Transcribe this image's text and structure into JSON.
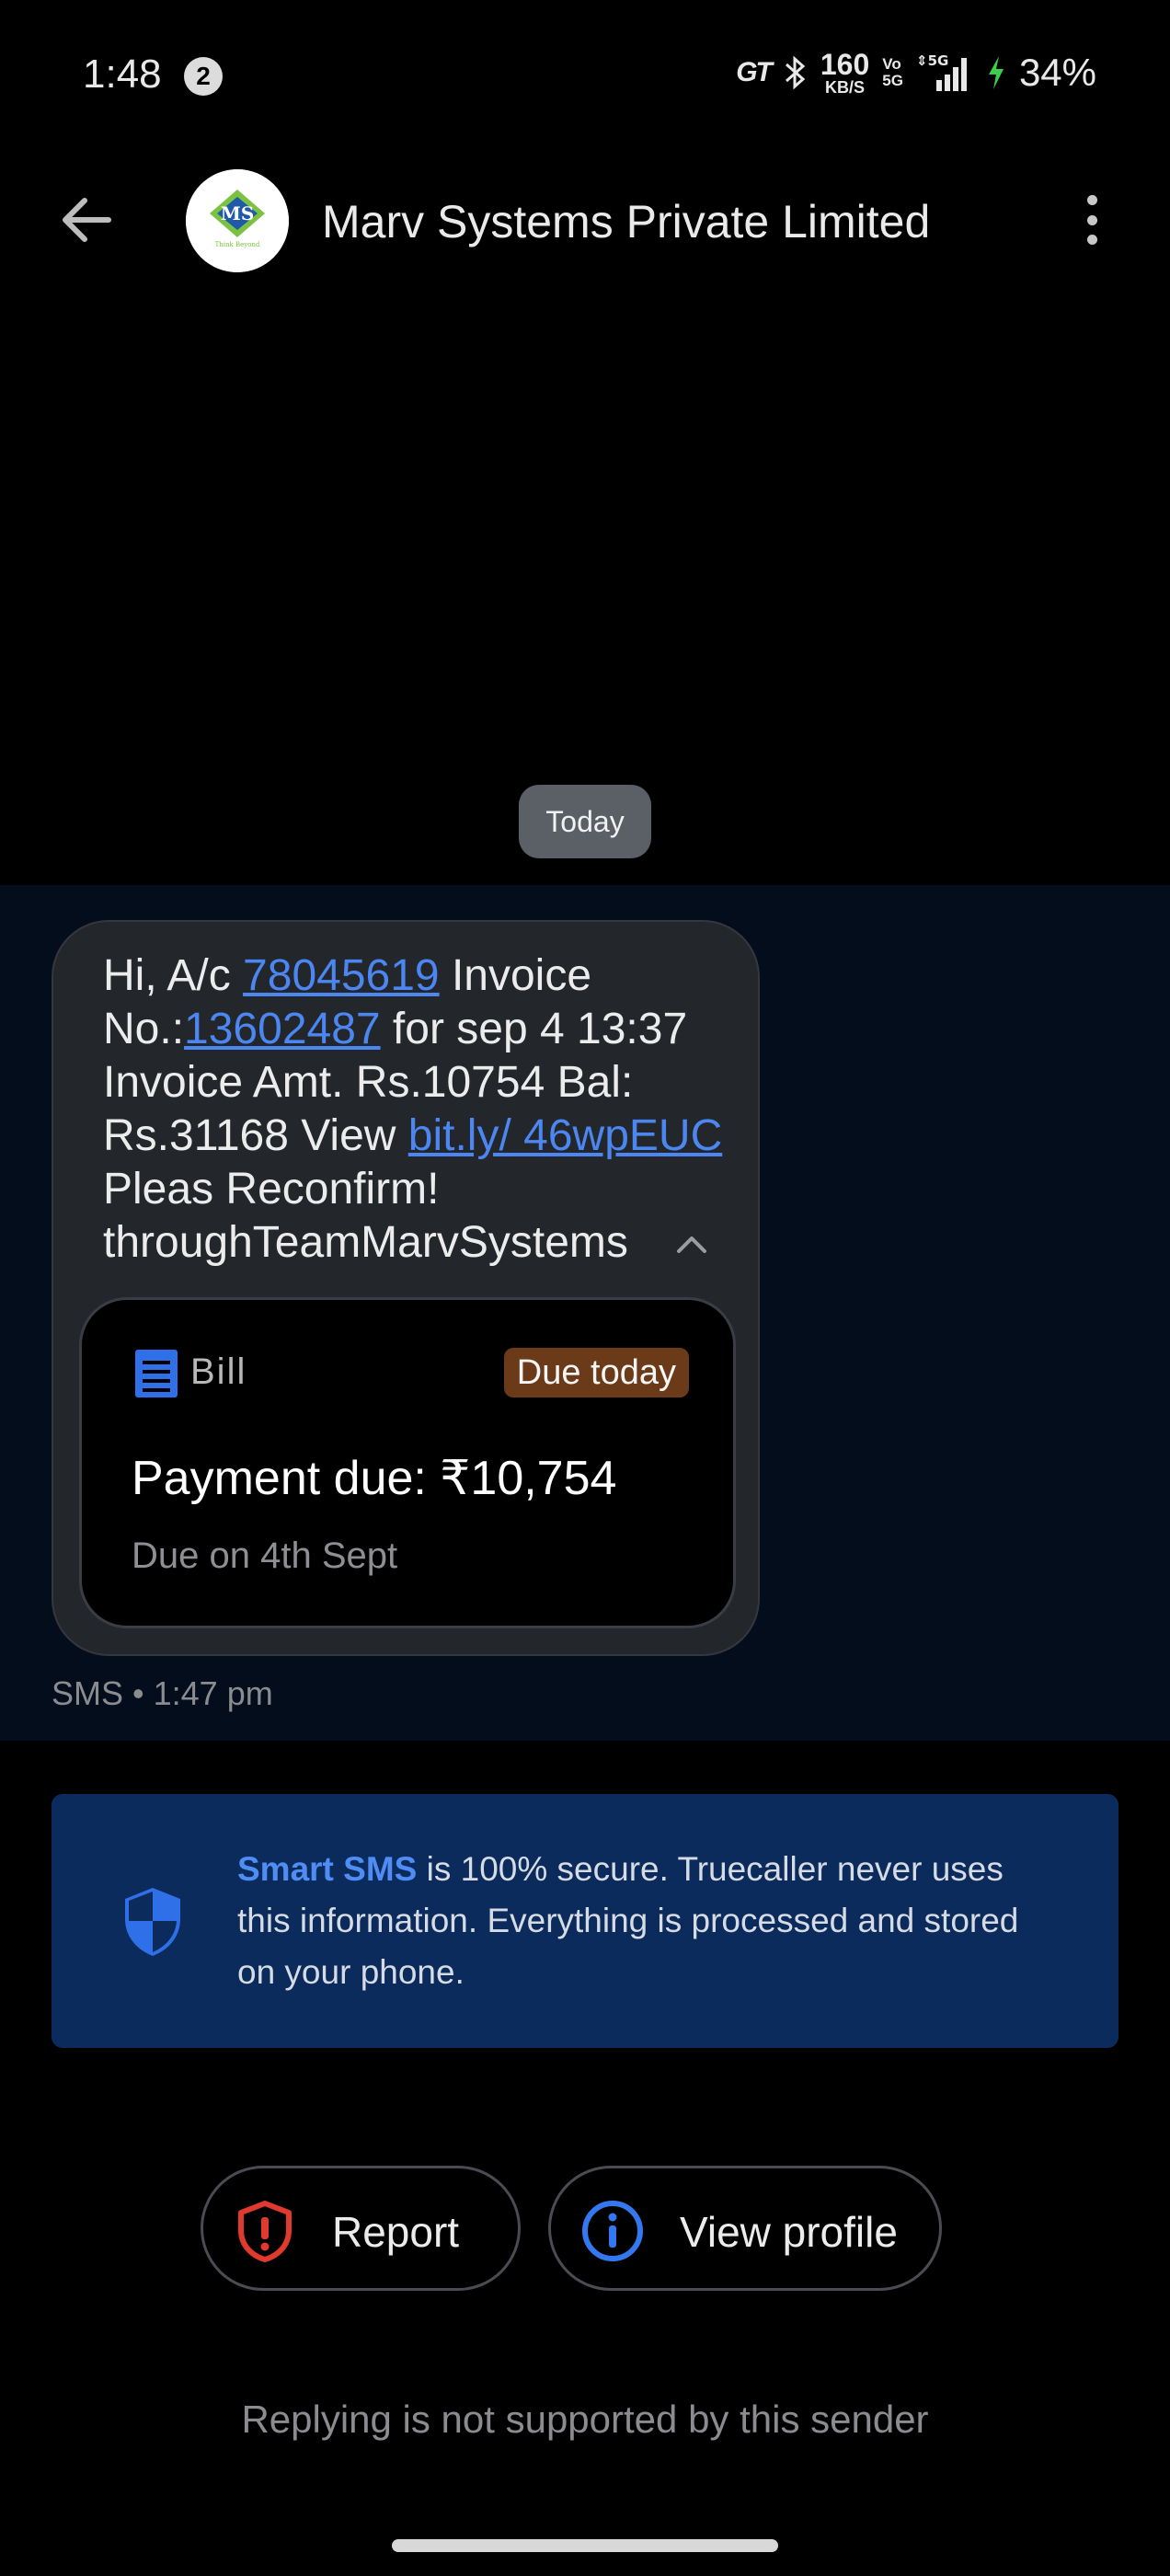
{
  "status_bar": {
    "time": "1:48",
    "notification_count": "2",
    "carrier_tag": "GT",
    "net_speed": "160",
    "net_speed_unit": "KB/S",
    "volte_top": "Vo",
    "volte_bottom": "5G",
    "network": "5G",
    "battery": "34%"
  },
  "header": {
    "sender_name": "Marv Systems Private Limited",
    "avatar_text": "MS",
    "avatar_tagline": "Think Beyond"
  },
  "date_chip": "Today",
  "message": {
    "p1": "Hi, A/c ",
    "link1": "78045619",
    "p2": " Invoice No.:",
    "link2": "13602487",
    "p3": " for sep 4 13:37 Invoice Amt. Rs.10754 Bal: Rs.31168 View ",
    "link3": "bit.ly/ 46wpEUC",
    "p4": " Pleas Reconfirm! throughTeamMarvSystems",
    "meta": "SMS • 1:47 pm"
  },
  "bill_card": {
    "label": "Bill",
    "badge": "Due today",
    "payment": "Payment due: ₹10,754",
    "due_on": "Due on 4th Sept"
  },
  "secure_banner": {
    "highlight": "Smart SMS",
    "text": " is 100% secure. Truecaller never uses this information. Everything is processed and stored on your phone."
  },
  "actions": {
    "report": "Report",
    "view_profile": "View profile"
  },
  "reply_note": "Replying is not supported by this sender",
  "colors": {
    "link": "#4c86f0",
    "banner_bg": "#0b2b5c",
    "due_badge": "#6b3a18",
    "report_icon": "#e0392e",
    "info_icon": "#3478f0"
  }
}
